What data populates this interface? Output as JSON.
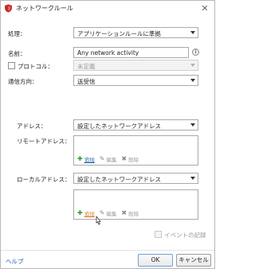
{
  "window": {
    "title": "ネットワークルール",
    "close_glyph": "✕"
  },
  "form": {
    "action": {
      "label": "処理：",
      "value": "アプリケーションルールに準拠"
    },
    "name": {
      "label": "名前：",
      "value": "Any network activity"
    },
    "protocol": {
      "label": "プロトコル：",
      "value": "未定義",
      "checked": false,
      "disabled": true
    },
    "direction": {
      "label": "通信方向：",
      "value": "送受信"
    },
    "address": {
      "label": "アドレス：",
      "value": "設定したネットワークアドレス"
    },
    "remote_address": {
      "label": "リモートアドレス：",
      "add": "追加",
      "edit": "編集",
      "delete": "削除"
    },
    "local_address": {
      "label": "ローカルアドレス：",
      "value": "設定したネットワークアドレス",
      "add": "追加",
      "edit": "編集",
      "delete": "削除"
    },
    "event_log": {
      "label": "イベントの記録",
      "checked": false,
      "disabled": true
    }
  },
  "footer": {
    "help": "ヘルプ",
    "ok": "OK",
    "cancel": "キャンセル"
  },
  "icons": {
    "app": "shield-icon",
    "info": "info-icon",
    "add": "plus-icon",
    "edit": "pencil-icon",
    "delete": "x-icon",
    "dropdown": "chevron-down-icon"
  }
}
